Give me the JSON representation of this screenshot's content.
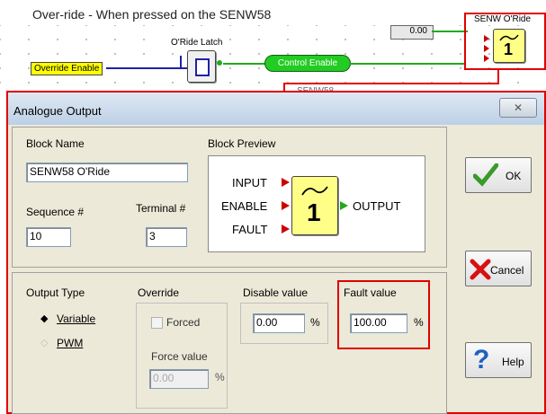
{
  "diagram": {
    "title": "Over-ride - When pressed on the SENW58",
    "oride_latch_label": "O'Ride Latch",
    "override_enable_label": "Override  Enable",
    "control_enable_label": "Control Enable",
    "value_box": "0.00",
    "senw_oride_label": "SENW O'Ride",
    "block_glyph": "1",
    "partial_label": "SENW58"
  },
  "dialog": {
    "title": "Analogue Output",
    "close_symbol": "✕",
    "block_name_label": "Block Name",
    "block_name_value": "SENW58 O'Ride",
    "block_preview_label": "Block Preview",
    "preview": {
      "input": "INPUT",
      "enable": "ENABLE",
      "fault": "FAULT",
      "output": "OUTPUT",
      "glyph": "1"
    },
    "sequence_label": "Sequence #",
    "sequence_value": "10",
    "terminal_label": "Terminal #",
    "terminal_value": "3",
    "output_type_label": "Output Type",
    "variable_label": "Variable",
    "pwm_label": "PWM",
    "override_label": "Override",
    "forced_label": "Forced",
    "force_value_label": "Force value",
    "force_value": "0.00",
    "disable_value_label": "Disable value",
    "disable_value": "0.00",
    "fault_value_label": "Fault value",
    "fault_value": "100.00",
    "percent": "%",
    "ok_label": "OK",
    "cancel_label": "Cancel",
    "help_label": "Help"
  }
}
